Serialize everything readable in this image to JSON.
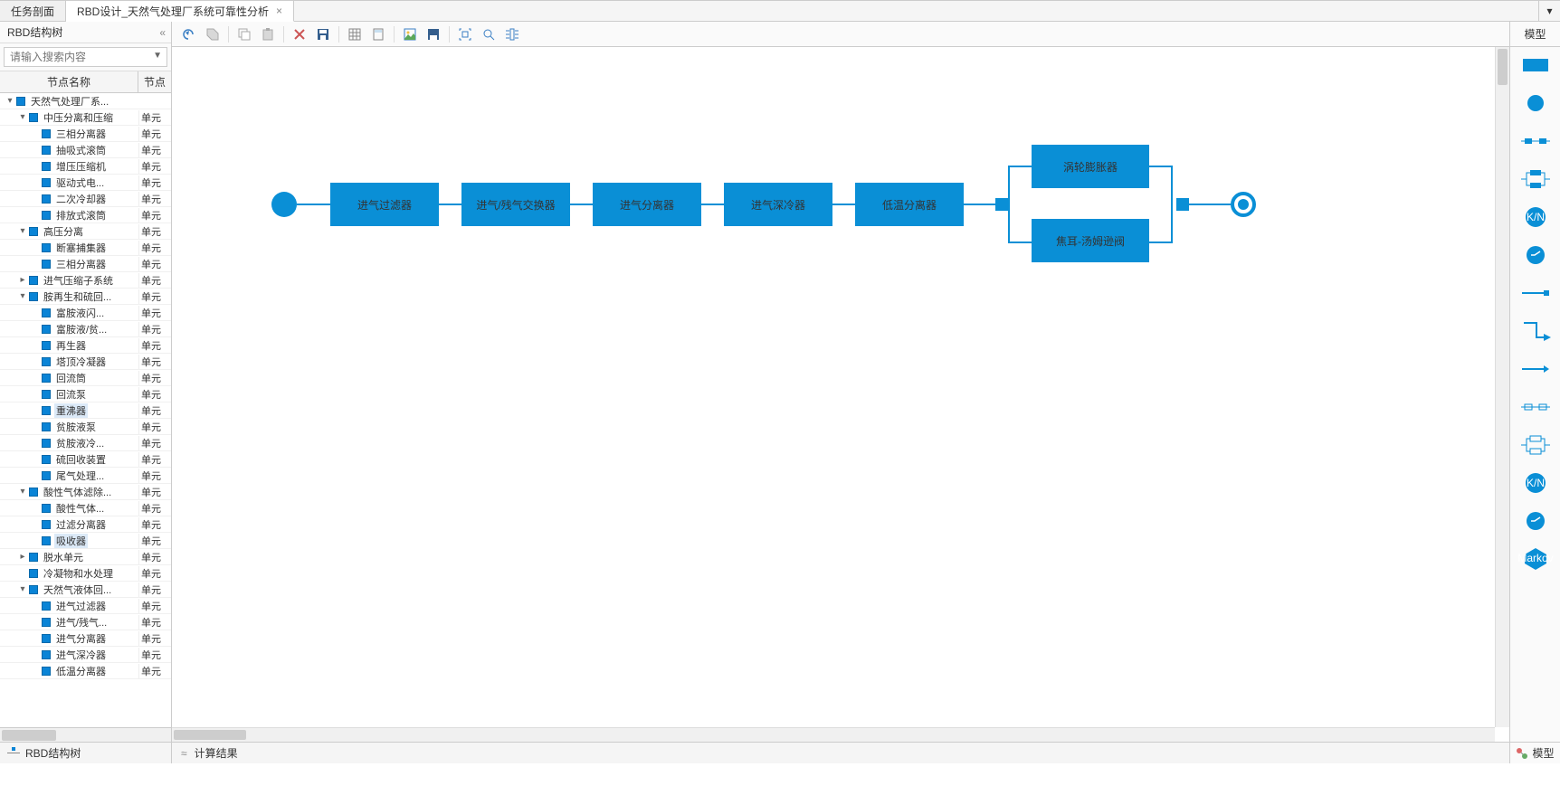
{
  "tabs": {
    "t0": "任务剖面",
    "t1": "RBD设计_天然气处理厂系统可靠性分析",
    "close": "×",
    "dd": "▾"
  },
  "sidebar": {
    "title": "RBD结构树",
    "collapse": "«",
    "search_ph": "请输入搜索内容",
    "hdr_name": "节点名称",
    "hdr_type": "节点",
    "foot": "RBD结构树"
  },
  "tree": {
    "n0": {
      "lbl": "天然气处理厂系...",
      "type": ""
    },
    "n1": {
      "lbl": "中压分离和压缩",
      "type": "单元"
    },
    "n2": {
      "lbl": "三相分离器",
      "type": "单元"
    },
    "n3": {
      "lbl": "抽吸式滚筒",
      "type": "单元"
    },
    "n4": {
      "lbl": "增压压缩机",
      "type": "单元"
    },
    "n5": {
      "lbl": "驱动式电...",
      "type": "单元"
    },
    "n6": {
      "lbl": "二次冷却器",
      "type": "单元"
    },
    "n7": {
      "lbl": "排放式滚筒",
      "type": "单元"
    },
    "n8": {
      "lbl": "高压分离",
      "type": "单元"
    },
    "n9": {
      "lbl": "断塞捕集器",
      "type": "单元"
    },
    "n10": {
      "lbl": "三相分离器",
      "type": "单元"
    },
    "n11": {
      "lbl": "进气压缩子系统",
      "type": "单元"
    },
    "n12": {
      "lbl": "胺再生和硫回...",
      "type": "单元"
    },
    "n13": {
      "lbl": "富胺液闪...",
      "type": "单元"
    },
    "n14": {
      "lbl": "富胺液/贫...",
      "type": "单元"
    },
    "n15": {
      "lbl": "再生器",
      "type": "单元"
    },
    "n16": {
      "lbl": "塔顶冷凝器",
      "type": "单元"
    },
    "n17": {
      "lbl": "回流筒",
      "type": "单元"
    },
    "n18": {
      "lbl": "回流泵",
      "type": "单元"
    },
    "n19": {
      "lbl": "重沸器",
      "type": "单元"
    },
    "n20": {
      "lbl": "贫胺液泵",
      "type": "单元"
    },
    "n21": {
      "lbl": "贫胺液冷...",
      "type": "单元"
    },
    "n22": {
      "lbl": "硫回收装置",
      "type": "单元"
    },
    "n23": {
      "lbl": "尾气处理...",
      "type": "单元"
    },
    "n24": {
      "lbl": "酸性气体滤除...",
      "type": "单元"
    },
    "n25": {
      "lbl": "酸性气体...",
      "type": "单元"
    },
    "n26": {
      "lbl": "过滤分离器",
      "type": "单元"
    },
    "n27": {
      "lbl": "吸收器",
      "type": "单元"
    },
    "n28": {
      "lbl": "脱水单元",
      "type": "单元"
    },
    "n29": {
      "lbl": "冷凝物和水处理",
      "type": "单元"
    },
    "n30": {
      "lbl": "天然气液体回...",
      "type": "单元"
    },
    "n31": {
      "lbl": "进气过滤器",
      "type": "单元"
    },
    "n32": {
      "lbl": "进气/残气...",
      "type": "单元"
    },
    "n33": {
      "lbl": "进气分离器",
      "type": "单元"
    },
    "n34": {
      "lbl": "进气深冷器",
      "type": "单元"
    },
    "n35": {
      "lbl": "低温分离器",
      "type": "单元"
    }
  },
  "diagram": {
    "b1": "进气过滤器",
    "b2": "进气/残气交换器",
    "b3": "进气分离器",
    "b4": "进气深冷器",
    "b5": "低温分离器",
    "b6": "涡轮膨胀器",
    "b7": "焦耳-汤姆逊阀"
  },
  "right": {
    "title": "模型",
    "kn": "K/N",
    "markov": "Markov",
    "foot": "模型"
  },
  "bottom": {
    "up": "≈",
    "label": "计算结果"
  },
  "toolbar_label": "模型"
}
